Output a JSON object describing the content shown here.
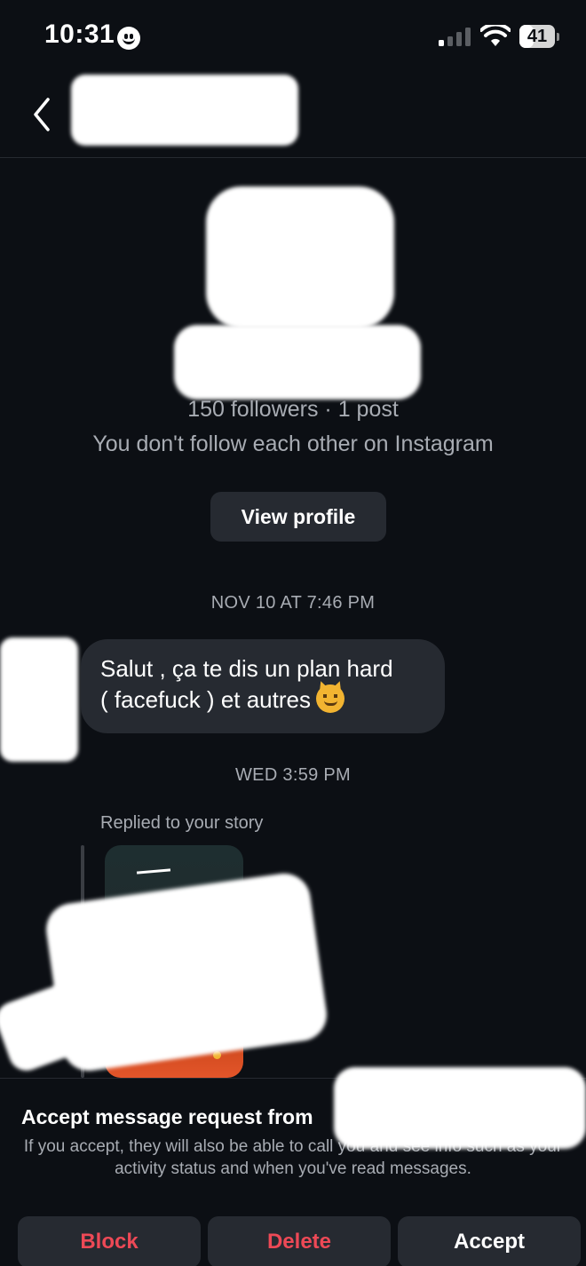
{
  "status_bar": {
    "time": "10:31",
    "battery": "41"
  },
  "profile": {
    "stats": "150 followers · 1 post",
    "relation": "You don't follow each other on Instagram",
    "view_profile_label": "View profile"
  },
  "conversation": {
    "timestamp_1": "NOV 10 AT 7:46 PM",
    "message_1_line_1": "Salut , ça te dis un plan hard",
    "message_1_line_2": "( facefuck ) et autres",
    "message_1_emoji": "smiling-cat-with-horns-emoji",
    "timestamp_2": "WED 3:59 PM",
    "story_reply_caption": "Replied to your story"
  },
  "request_sheet": {
    "title": "Accept message request from",
    "description": "If you accept, they will also be able to call you and see info such as your activity status and when you've read messages.",
    "block_label": "Block",
    "delete_label": "Delete",
    "accept_label": "Accept"
  },
  "colors": {
    "background": "#0c0f14",
    "bubble": "#262a31",
    "secondary_text": "#a8acb3",
    "destructive": "#ed4956"
  }
}
